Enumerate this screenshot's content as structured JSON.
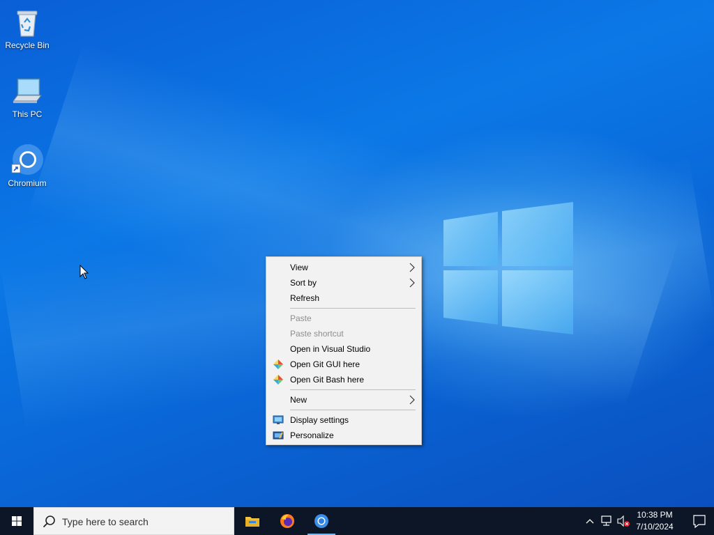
{
  "desktop": {
    "icons": [
      {
        "label": "Recycle Bin",
        "icon": "recycle-bin-icon"
      },
      {
        "label": "This PC",
        "icon": "computer-icon"
      },
      {
        "label": "Chromium",
        "icon": "chromium-icon"
      }
    ]
  },
  "context_menu": {
    "items": [
      {
        "label": "View",
        "submenu": true,
        "enabled": true
      },
      {
        "label": "Sort by",
        "submenu": true,
        "enabled": true
      },
      {
        "label": "Refresh",
        "submenu": false,
        "enabled": true
      },
      {
        "label": "Paste",
        "submenu": false,
        "enabled": false
      },
      {
        "label": "Paste shortcut",
        "submenu": false,
        "enabled": false
      },
      {
        "label": "Open in Visual Studio",
        "submenu": false,
        "enabled": true
      },
      {
        "label": "Open Git GUI here",
        "submenu": false,
        "enabled": true,
        "icon": "git-icon"
      },
      {
        "label": "Open Git Bash here",
        "submenu": false,
        "enabled": true,
        "icon": "git-icon"
      },
      {
        "label": "New",
        "submenu": true,
        "enabled": true
      },
      {
        "label": "Display settings",
        "submenu": false,
        "enabled": true,
        "icon": "display-icon"
      },
      {
        "label": "Personalize",
        "submenu": false,
        "enabled": true,
        "icon": "personalize-icon"
      }
    ]
  },
  "taskbar": {
    "search_placeholder": "Type here to search",
    "apps": [
      {
        "name": "File Explorer",
        "icon": "folder-icon"
      },
      {
        "name": "Firefox",
        "icon": "firefox-icon"
      },
      {
        "name": "Chromium",
        "icon": "chromium-icon",
        "active": true
      }
    ],
    "clock": {
      "time": "10:38 PM",
      "date": "7/10/2024"
    }
  },
  "colors": {
    "desktop_blue": "#0b78e6",
    "taskbar": "#0d1626",
    "menu_bg": "#f2f2f2",
    "disabled_text": "#8d8d8d"
  }
}
